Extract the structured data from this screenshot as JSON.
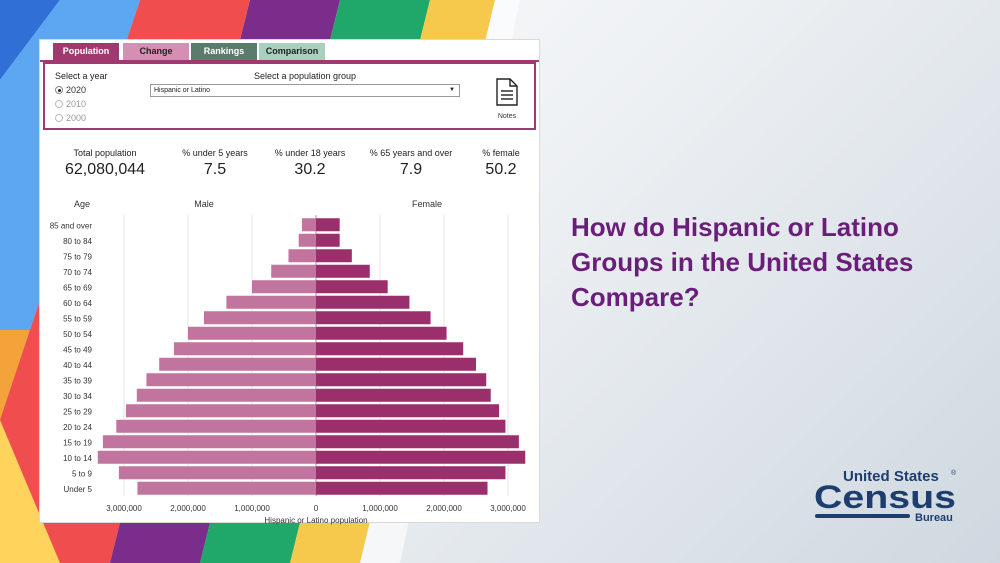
{
  "tabs": [
    {
      "label": "Population",
      "bg": "#a0396f",
      "color": "#ffffff"
    },
    {
      "label": "Change",
      "bg": "#d58fb4",
      "color": "#222222"
    },
    {
      "label": "Rankings",
      "bg": "#5a7c6a",
      "color": "#ffffff"
    },
    {
      "label": "Comparison",
      "bg": "#a8d0bc",
      "color": "#222222"
    }
  ],
  "year_select": {
    "label": "Select a year",
    "options": [
      "2020",
      "2010",
      "2000"
    ],
    "selected": "2020"
  },
  "group_select": {
    "label": "Select a population group",
    "value": "Hispanic or Latino",
    "arrow": "▼"
  },
  "notes": {
    "label": "Notes",
    "icon": "document-icon"
  },
  "stats": [
    {
      "label": "Total population",
      "value": "62,080,044"
    },
    {
      "label": "% under 5 years",
      "value": "7.5"
    },
    {
      "label": "% under 18 years",
      "value": "30.2"
    },
    {
      "label": "% 65 years and over",
      "value": "7.9"
    },
    {
      "label": "% female",
      "value": "50.2"
    }
  ],
  "headline": "How do Hispanic or Latino Groups in the United States Compare?",
  "logo": {
    "line1": "United States",
    "registered": "®",
    "line2": "Census",
    "line3": "Bureau"
  },
  "colors": {
    "accent": "#a0396f",
    "male": "#c0749e",
    "female": "#9a2f6c",
    "headline": "#6a1e7a",
    "logo": "#1e3d6e"
  },
  "chart_data": {
    "type": "bar",
    "orientation": "horizontal-population-pyramid",
    "col_header": "Age",
    "xlabel": "Hispanic or Latino population",
    "categories": [
      "85 and over",
      "80 to 84",
      "75 to 79",
      "70 to 74",
      "65 to 69",
      "60 to 64",
      "55 to 59",
      "50 to 54",
      "45 to 49",
      "40 to 44",
      "35 to 39",
      "30 to 34",
      "25 to 29",
      "20 to 24",
      "15 to 19",
      "10 to 14",
      "5 to 9",
      "Under 5"
    ],
    "series": [
      {
        "name": "Male",
        "values": [
          220000,
          270000,
          430000,
          700000,
          1000000,
          1400000,
          1750000,
          2000000,
          2220000,
          2450000,
          2650000,
          2800000,
          2970000,
          3120000,
          3330000,
          3410000,
          3080000,
          2790000
        ]
      },
      {
        "name": "Female",
        "values": [
          370000,
          370000,
          560000,
          840000,
          1120000,
          1460000,
          1790000,
          2040000,
          2300000,
          2500000,
          2660000,
          2730000,
          2860000,
          2960000,
          3170000,
          3270000,
          2960000,
          2680000
        ]
      }
    ],
    "xticks": [
      {
        "value": -3000000,
        "label": "3,000,000"
      },
      {
        "value": -2000000,
        "label": "2,000,000"
      },
      {
        "value": -1000000,
        "label": "1,000,000"
      },
      {
        "value": 0,
        "label": "0"
      },
      {
        "value": 1000000,
        "label": "1,000,000"
      },
      {
        "value": 2000000,
        "label": "2,000,000"
      },
      {
        "value": 3000000,
        "label": "3,000,000"
      }
    ],
    "xlim": [
      -3500000,
      3500000
    ],
    "grid": true
  }
}
